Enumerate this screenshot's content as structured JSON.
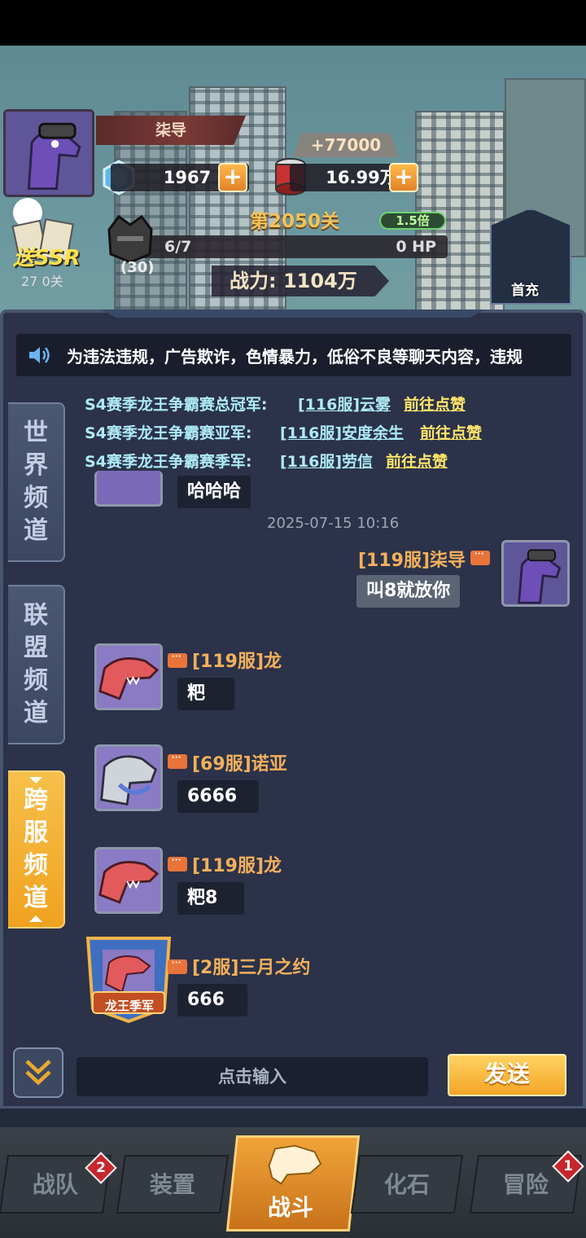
{
  "player": {
    "name": "柒导",
    "gems": "1967",
    "food": "16.99万",
    "bonus": "+77000"
  },
  "stage": {
    "label": "第2050关",
    "speed": "1.5倍",
    "hp_count": "6/7",
    "hp_text": "0 HP",
    "boss_level": "(30)",
    "power": "战力: 1104万"
  },
  "ssr": {
    "label": "送SSR",
    "sub": "27 0关"
  },
  "first_charge": "首充",
  "notice": "为违法违规，广告欺诈，色情暴力，低俗不良等聊天内容，违规",
  "channels": {
    "world": [
      "世",
      "界",
      "频",
      "道"
    ],
    "alliance": [
      "联",
      "盟",
      "频",
      "道"
    ],
    "cross": [
      "跨",
      "服",
      "频",
      "道"
    ]
  },
  "champions": [
    {
      "title": "S4赛季龙王争霸赛总冠军:",
      "name": "[116服]云雾",
      "like": "前往点赞"
    },
    {
      "title": "S4赛季龙王争霸赛亚军:",
      "name": "[116服]安度余生",
      "like": "前往点赞"
    },
    {
      "title": "S4赛季龙王争霸赛季军:",
      "name": "[116服]劳信",
      "like": "前往点赞"
    }
  ],
  "timestamp": "2025-07-15 10:16",
  "messages": [
    {
      "name": "",
      "text": "哈哈哈"
    },
    {
      "name": "[119服]柒导",
      "text": "叫8就放你"
    },
    {
      "name": "[119服]龙",
      "text": "粑"
    },
    {
      "name": "[69服]诺亚",
      "text": "6666"
    },
    {
      "name": "[119服]龙",
      "text": "粑8"
    },
    {
      "name": "[2服]三月之约",
      "text": "666",
      "frame_label": "龙王季军"
    }
  ],
  "input": {
    "placeholder": "点击输入",
    "send": "发送"
  },
  "nav": {
    "team": "战队",
    "equip": "装置",
    "battle": "战斗",
    "fossil": "化石",
    "adventure": "冒险",
    "team_badge": "2",
    "adventure_badge": "1"
  },
  "colors": {
    "accent": "#f4a526",
    "name": "#f3b05b",
    "champion": "#aeeaf7",
    "like": "#ffe56a"
  }
}
